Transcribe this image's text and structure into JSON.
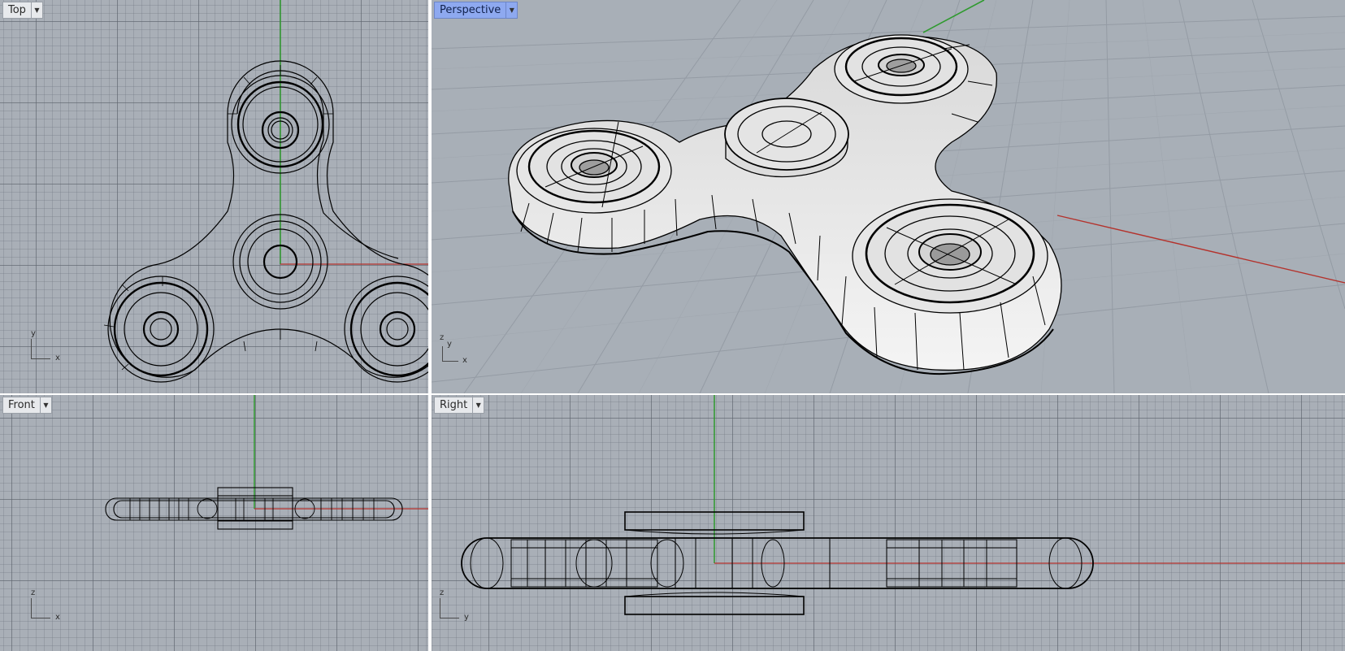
{
  "viewports": {
    "top": {
      "title": "Top",
      "axis_h": "x",
      "axis_v": "y"
    },
    "persp": {
      "title": "Perspective",
      "axis_h": "x",
      "axis_v": "y",
      "axis_z": "z"
    },
    "front": {
      "title": "Front",
      "axis_h": "x",
      "axis_v": "z"
    },
    "right": {
      "title": "Right",
      "axis_h": "y",
      "axis_v": "z"
    }
  },
  "dropdown_icon": "triangle-down-icon",
  "colors": {
    "background": "#a9afb7",
    "grid": "#5c626c",
    "x_axis": "#b4322c",
    "y_axis": "#2f9a2f",
    "z_axis": "#2f9a2f",
    "wire": "#000000",
    "surface": "#e9e9e9",
    "active_label": "#8ea9f0"
  }
}
